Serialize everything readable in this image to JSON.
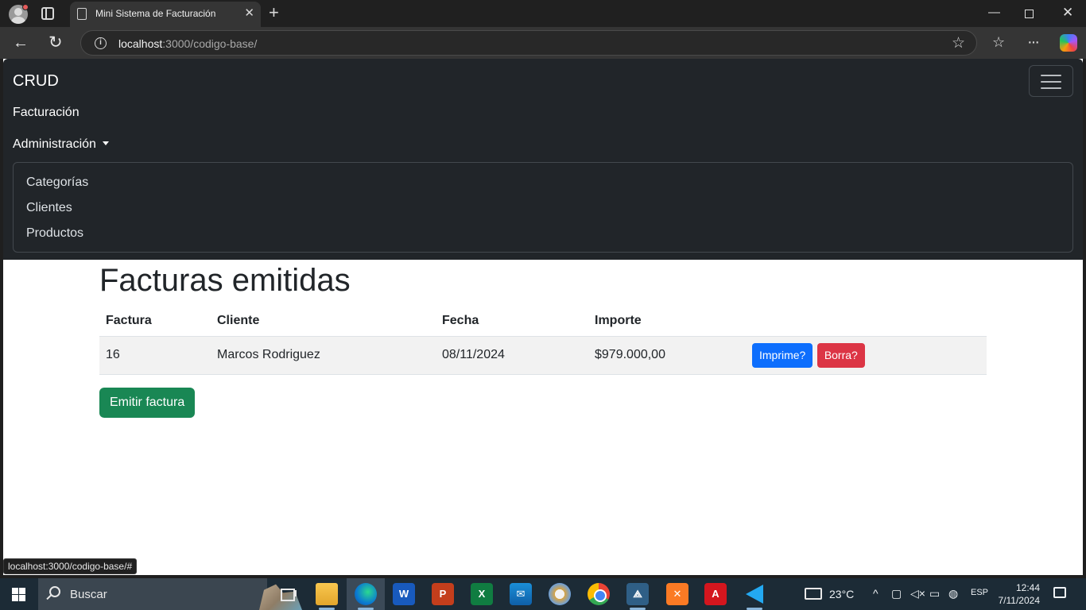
{
  "browser": {
    "tab_title": "Mini Sistema de Facturación",
    "url_host": "localhost",
    "url_path": ":3000/codigo-base/",
    "status_url": "localhost:3000/codigo-base/#",
    "icons": [
      "profile-icon",
      "tab-actions-icon",
      "page-icon",
      "close-icon",
      "new-tab-icon",
      "minimize-icon",
      "maximize-icon",
      "window-close-icon",
      "back-icon",
      "reload-icon",
      "site-info-icon",
      "favorite-star-icon",
      "favorites-icon",
      "more-icon",
      "copilot-icon"
    ]
  },
  "navbar": {
    "brand": "CRUD",
    "links": {
      "facturacion": "Facturación",
      "administracion": "Administración"
    },
    "dropdown": [
      "Categorías",
      "Clientes",
      "Productos"
    ]
  },
  "main": {
    "title": "Facturas emitidas",
    "table": {
      "headers": [
        "Factura",
        "Cliente",
        "Fecha",
        "Importe"
      ],
      "rows": [
        {
          "factura": "16",
          "cliente": "Marcos Rodriguez",
          "fecha": "08/11/2024",
          "importe": "$979.000,00",
          "print_label": "Imprime?",
          "delete_label": "Borra?"
        }
      ]
    },
    "emit_button": "Emitir factura"
  },
  "taskbar": {
    "search_text": "Buscar",
    "temperature": "23°C",
    "language": "ESP",
    "time": "12:44",
    "date": "7/11/2024",
    "apps": [
      "task-view",
      "file-explorer",
      "edge",
      "word",
      "powerpoint",
      "excel",
      "mail",
      "paint",
      "chrome",
      "mysql-workbench",
      "xampp",
      "acrobat",
      "vscode"
    ]
  },
  "colors": {
    "navbar_bg": "#212529",
    "primary": "#0d6efd",
    "danger": "#dc3545",
    "success": "#198754"
  }
}
